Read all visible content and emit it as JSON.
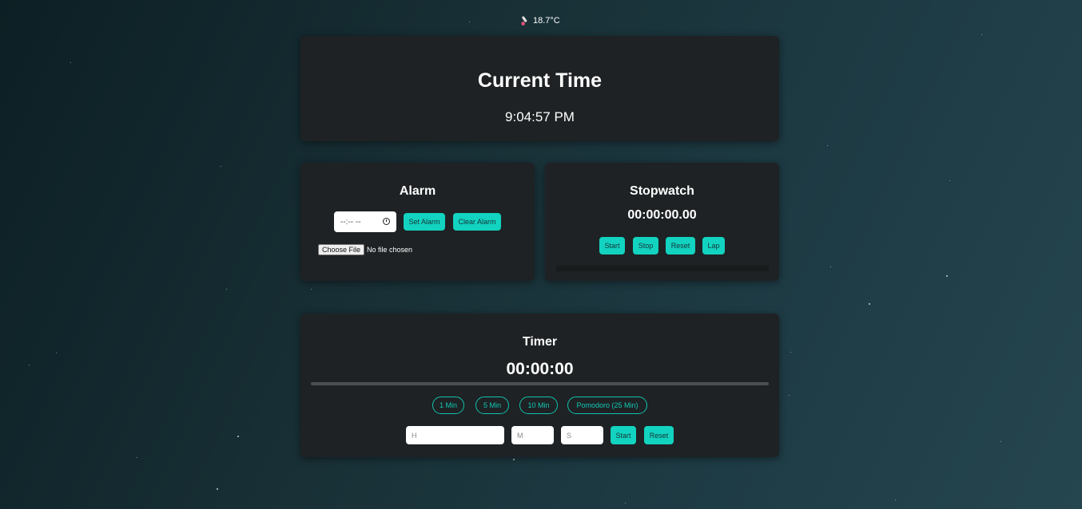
{
  "weather": {
    "icon": "thermometer-icon",
    "temperature": "18.7°C"
  },
  "clock": {
    "title": "Current Time",
    "time": "9:04:57 PM"
  },
  "alarm": {
    "title": "Alarm",
    "time_placeholder": "--:-- --",
    "set_label": "Set Alarm",
    "clear_label": "Clear Alarm",
    "file_button": "Choose File",
    "file_status": "No file chosen"
  },
  "stopwatch": {
    "title": "Stopwatch",
    "display": "00:00:00.00",
    "buttons": {
      "start": "Start",
      "stop": "Stop",
      "reset": "Reset",
      "lap": "Lap"
    }
  },
  "timer": {
    "title": "Timer",
    "display": "00:00:00",
    "progress": 0,
    "presets": [
      "1 Min",
      "5 Min",
      "10 Min",
      "Pomodoro (25 Min)"
    ],
    "inputs": {
      "hours_placeholder": "H",
      "minutes_placeholder": "M",
      "seconds_placeholder": "S"
    },
    "start_label": "Start",
    "reset_label": "Reset"
  },
  "colors": {
    "accent": "#12d3c0",
    "card": "#1e2224",
    "background": "#183036"
  }
}
